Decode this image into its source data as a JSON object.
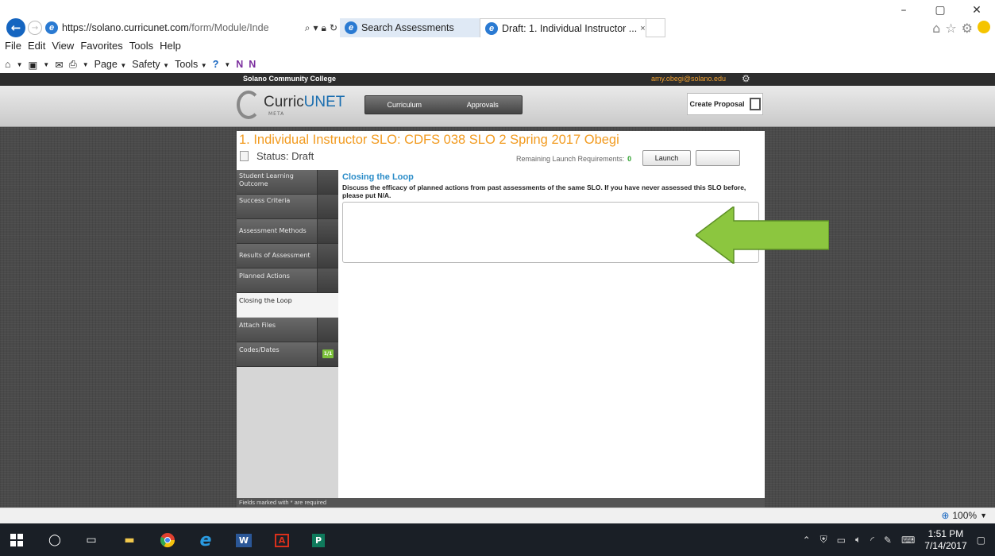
{
  "browser": {
    "url_host": "https://solano.curricunet.com",
    "url_path": "/form/Module/Inde",
    "tabs": [
      {
        "label": "Search Assessments"
      },
      {
        "label": "Draft: 1. Individual Instructor ..."
      }
    ],
    "tab_close": "×",
    "menu": [
      "File",
      "Edit",
      "View",
      "Favorites",
      "Tools",
      "Help"
    ],
    "commands": [
      "Page",
      "Safety",
      "Tools"
    ],
    "window_controls": [
      "–",
      "▢",
      "✕"
    ],
    "zoom": "100%"
  },
  "site": {
    "college": "Solano Community College",
    "user_email": "amy.obegi@solano.edu",
    "logo_text_a": "Curric",
    "logo_text_b": "UNET",
    "logo_sub": "META",
    "nav": [
      "Curriculum",
      "Approvals"
    ],
    "create_proposal": "Create Proposal"
  },
  "form": {
    "title": "1. Individual Instructor SLO: CDFS 038 SLO 2 Spring 2017 Obegi",
    "status": "Status: Draft",
    "remaining_label": "Remaining Launch Requirements:",
    "remaining_count": "0",
    "launch_label": "Launch",
    "sidebar": [
      {
        "label": "Student Learning Outcome"
      },
      {
        "label": "Success Criteria"
      },
      {
        "label": "Assessment Methods"
      },
      {
        "label": "Results of Assessment"
      },
      {
        "label": "Planned Actions"
      },
      {
        "label": "Closing the Loop"
      },
      {
        "label": "Attach Files"
      },
      {
        "label": "Codes/Dates"
      }
    ],
    "codes_badge": "1/1",
    "section_title": "Closing the Loop",
    "question": "Discuss the efficacy of planned actions from past assessments of the same SLO. If you have never assessed this SLO before, please put N/A.",
    "answer_value": "",
    "required_note": "Fields marked with * are required"
  },
  "taskbar": {
    "time": "1:51 PM",
    "date": "7/14/2017"
  },
  "colors": {
    "title_orange": "#f29b20",
    "section_blue": "#2a8cc8",
    "arrow_green": "#8cc63f"
  }
}
